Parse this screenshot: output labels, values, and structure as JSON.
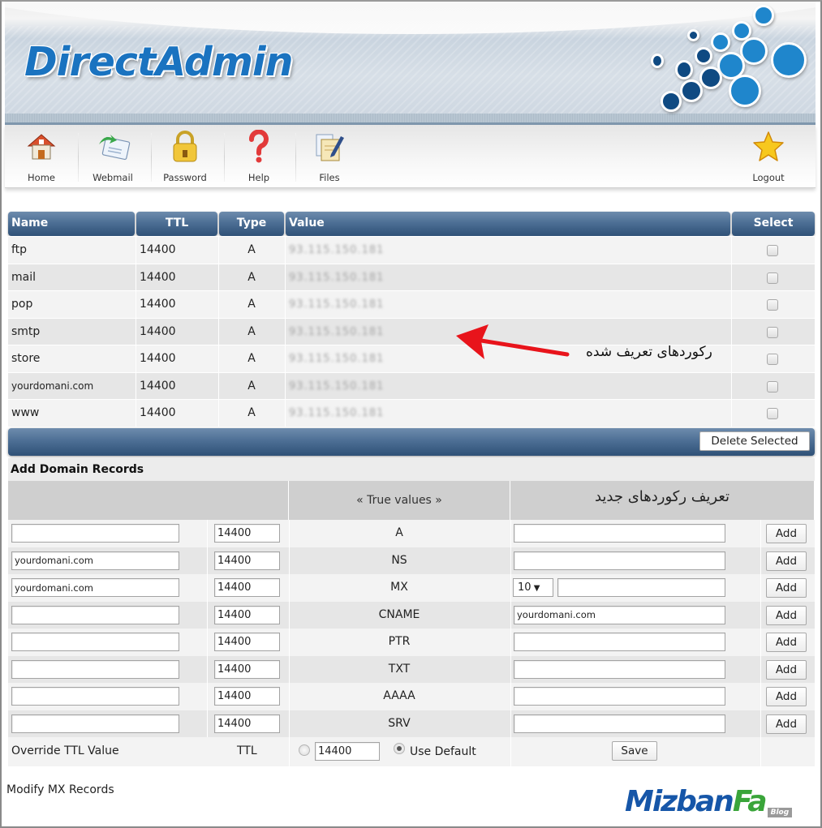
{
  "header": {
    "logo_text": "DirectAdmin"
  },
  "toolbar": {
    "items": [
      {
        "label": "Home",
        "icon": "home-icon"
      },
      {
        "label": "Webmail",
        "icon": "webmail-icon"
      },
      {
        "label": "Password",
        "icon": "lock-icon"
      },
      {
        "label": "Help",
        "icon": "help-icon"
      },
      {
        "label": "Files",
        "icon": "files-icon"
      }
    ],
    "logout": {
      "label": "Logout",
      "icon": "star-icon"
    }
  },
  "records": {
    "columns": [
      "Name",
      "TTL",
      "Type",
      "Value",
      "Select"
    ],
    "rows": [
      {
        "name": "ftp",
        "ttl": "14400",
        "type": "A",
        "value": "93.115.150.181",
        "selected": false
      },
      {
        "name": "mail",
        "ttl": "14400",
        "type": "A",
        "value": "93.115.150.181",
        "selected": false
      },
      {
        "name": "pop",
        "ttl": "14400",
        "type": "A",
        "value": "93.115.150.181",
        "selected": false
      },
      {
        "name": "smtp",
        "ttl": "14400",
        "type": "A",
        "value": "93.115.150.181",
        "selected": false
      },
      {
        "name": "store",
        "ttl": "14400",
        "type": "A",
        "value": "93.115.150.181",
        "selected": false
      },
      {
        "name": "yourdomani.com",
        "ttl": "14400",
        "type": "A",
        "value": "93.115.150.181",
        "selected": false
      },
      {
        "name": "www",
        "ttl": "14400",
        "type": "A",
        "value": "93.115.150.181",
        "selected": false
      }
    ],
    "delete_label": "Delete Selected"
  },
  "annotation": {
    "defined_records": "رکوردهای تعریف شده",
    "arrow_color": "#e8141b"
  },
  "add_records": {
    "title": "Add Domain Records",
    "true_values_label": "« True values »",
    "new_records_label": "تعریف رکوردهای جدید",
    "rows": [
      {
        "name": "",
        "ttl": "14400",
        "type": "A",
        "value": "",
        "add_label": "Add"
      },
      {
        "name": "yourdomani.com",
        "ttl": "14400",
        "type": "NS",
        "value": "",
        "add_label": "Add"
      },
      {
        "name": "yourdomani.com",
        "ttl": "14400",
        "type": "MX",
        "priority": "10",
        "value": "",
        "add_label": "Add"
      },
      {
        "name": "",
        "ttl": "14400",
        "type": "CNAME",
        "value": "yourdomani.com",
        "add_label": "Add"
      },
      {
        "name": "",
        "ttl": "14400",
        "type": "PTR",
        "value": "",
        "add_label": "Add"
      },
      {
        "name": "",
        "ttl": "14400",
        "type": "TXT",
        "value": "",
        "add_label": "Add"
      },
      {
        "name": "",
        "ttl": "14400",
        "type": "AAAA",
        "value": "",
        "add_label": "Add"
      },
      {
        "name": "",
        "ttl": "14400",
        "type": "SRV",
        "value": "",
        "add_label": "Add"
      }
    ],
    "override": {
      "label": "Override TTL Value",
      "ttl_label": "TTL",
      "ttl_value": "14400",
      "custom_selected": false,
      "use_default_label": "Use Default",
      "use_default_selected": true,
      "save_label": "Save"
    }
  },
  "footer": {
    "modify_mx_label": "Modify MX Records",
    "brand_part1": "Mizban",
    "brand_part2": "Fa",
    "brand_tag": "Blog"
  }
}
